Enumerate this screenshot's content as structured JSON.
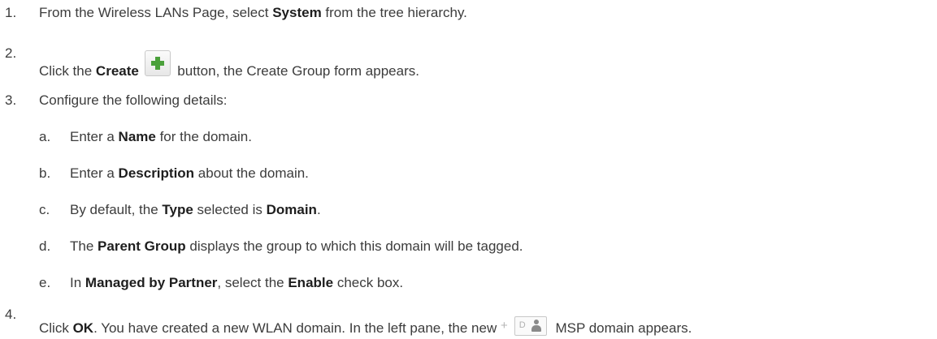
{
  "steps": [
    {
      "num": "1.",
      "pre": "From the Wireless LANs Page, select ",
      "bold": "System",
      "post": " from the tree hierarchy."
    },
    {
      "num": "2.",
      "pre": "Click the ",
      "bold": "Create",
      "post": " button, the Create Group form appears.",
      "icon": "create-plus-icon"
    },
    {
      "num": "3.",
      "text": "Configure the following details:",
      "substeps": [
        {
          "letter": "a.",
          "pre": "Enter a ",
          "bold": "Name",
          "post": " for the domain."
        },
        {
          "letter": "b.",
          "pre": "Enter a ",
          "bold": "Description",
          "post": " about the domain."
        },
        {
          "letter": "c.",
          "pre": "By default, the ",
          "bold": "Type",
          "mid": " selected is ",
          "bold2": "Domain",
          "post": "."
        },
        {
          "letter": "d.",
          "pre": "The ",
          "bold": "Parent Group",
          "post": " displays the group to which this domain will be tagged."
        },
        {
          "letter": "e.",
          "pre": "In ",
          "bold": "Managed by Partner",
          "mid": ", select the ",
          "bold2": "Enable",
          "post": " check box."
        }
      ]
    },
    {
      "num": "4.",
      "pre": "Click ",
      "bold": "OK",
      "mid": ". You have created a new WLAN domain. In the left pane, the new ",
      "post": " MSP domain appears.",
      "icon_plus": "+",
      "icon_domain_letter": "D",
      "icon": "msp-domain-icon"
    }
  ]
}
